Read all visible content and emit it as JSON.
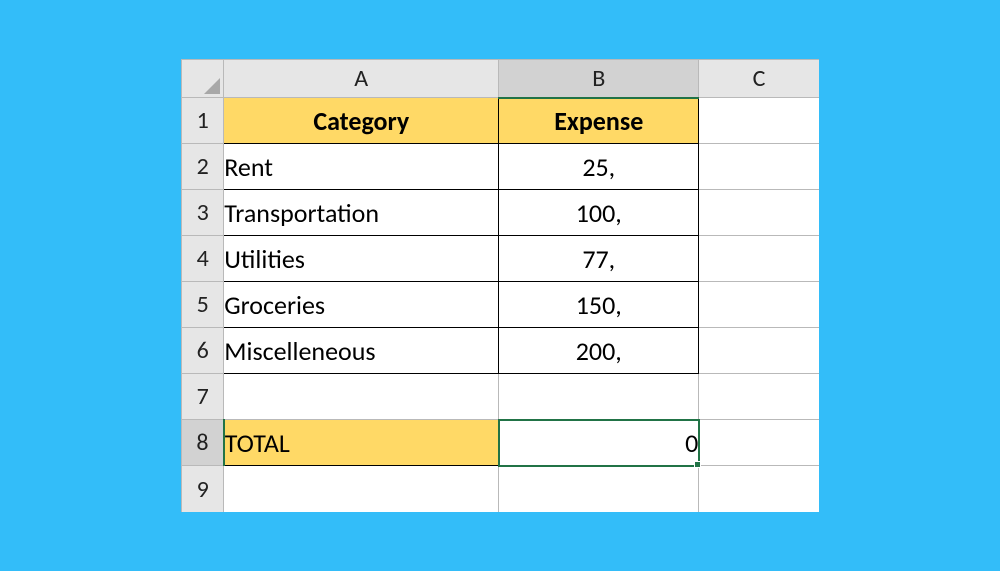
{
  "columns": {
    "A": "A",
    "B": "B",
    "C": "C"
  },
  "row_numbers": [
    "1",
    "2",
    "3",
    "4",
    "5",
    "6",
    "7",
    "8",
    "9"
  ],
  "headers": {
    "category": "Category",
    "expense": "Expense"
  },
  "rows": [
    {
      "category": "Rent",
      "expense": "25,"
    },
    {
      "category": "Transportation",
      "expense": "100,"
    },
    {
      "category": "Utilities",
      "expense": "77,"
    },
    {
      "category": "Groceries",
      "expense": "150,"
    },
    {
      "category": "Miscelleneous",
      "expense": "200,"
    }
  ],
  "total": {
    "label": "TOTAL",
    "value": "0"
  },
  "chart_data": {
    "type": "table",
    "title": "",
    "columns": [
      "Category",
      "Expense"
    ],
    "rows": [
      [
        "Rent",
        "25,"
      ],
      [
        "Transportation",
        "100,"
      ],
      [
        "Utilities",
        "77,"
      ],
      [
        "Groceries",
        "150,"
      ],
      [
        "Miscelleneous",
        "200,"
      ],
      [
        "TOTAL",
        "0"
      ]
    ]
  }
}
